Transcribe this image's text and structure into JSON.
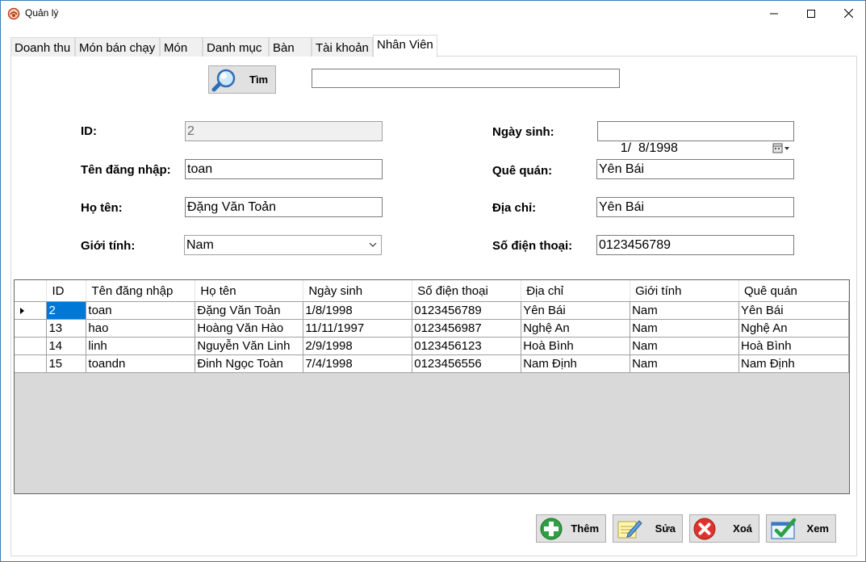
{
  "window": {
    "title": "Quản lý",
    "min_glyph": "—",
    "max_glyph": "☐",
    "close_glyph": "✕"
  },
  "tabs": [
    {
      "label": "Doanh thu"
    },
    {
      "label": "Món bán chạy"
    },
    {
      "label": "Món"
    },
    {
      "label": "Danh mục"
    },
    {
      "label": "Bàn"
    },
    {
      "label": "Tài khoản"
    },
    {
      "label": "Nhân Viên",
      "active": true
    }
  ],
  "search": {
    "button_label": "Tìm",
    "value": ""
  },
  "form": {
    "id_label": "ID:",
    "id_value": "2",
    "username_label": "Tên đăng nhập:",
    "username_value": "toan",
    "fullname_label": "Họ tên:",
    "fullname_value": "Đặng Văn Toản",
    "gender_label": "Giới tính:",
    "gender_value": "Nam",
    "birthdate_label": "Ngày sinh:",
    "birthdate_value": "1/  8/1998",
    "hometown_label": "Quê quán:",
    "hometown_value": "Yên Bái",
    "address_label": "Địa chỉ:",
    "address_value": "Yên Bái",
    "phone_label": "Số điện thoại:",
    "phone_value": "0123456789"
  },
  "grid": {
    "columns": [
      "ID",
      "Tên đăng nhập",
      "Họ tên",
      "Ngày sinh",
      "Số điện thoại",
      "Địa chỉ",
      "Giới tính",
      "Quê quán"
    ],
    "rows": [
      [
        "2",
        "toan",
        "Đặng Văn Toản",
        "1/8/1998",
        "0123456789",
        "Yên Bái",
        "Nam",
        "Yên Bái"
      ],
      [
        "13",
        "hao",
        "Hoàng Văn Hào",
        "11/11/1997",
        "0123456987",
        "Nghệ An",
        "Nam",
        "Nghệ An"
      ],
      [
        "14",
        "linh",
        "Nguyễn Văn Linh",
        "2/9/1998",
        "0123456123",
        "Hoà Bình",
        "Nam",
        "Hoà Bình"
      ],
      [
        "15",
        "toandn",
        "Đinh Ngọc Toàn",
        "7/4/1998",
        "0123456556",
        "Nam Định",
        "Nam",
        "Nam Định"
      ]
    ],
    "selection_color": "#0078d7"
  },
  "actions": {
    "add_label": "Thêm",
    "edit_label": "Sửa",
    "delete_label": "Xoá",
    "view_label": "Xem"
  },
  "icons": {
    "search": "magnifier-icon",
    "add": "plus-icon",
    "edit": "edit-note-icon",
    "delete": "x-circle-icon",
    "view": "checkmark-icon"
  }
}
